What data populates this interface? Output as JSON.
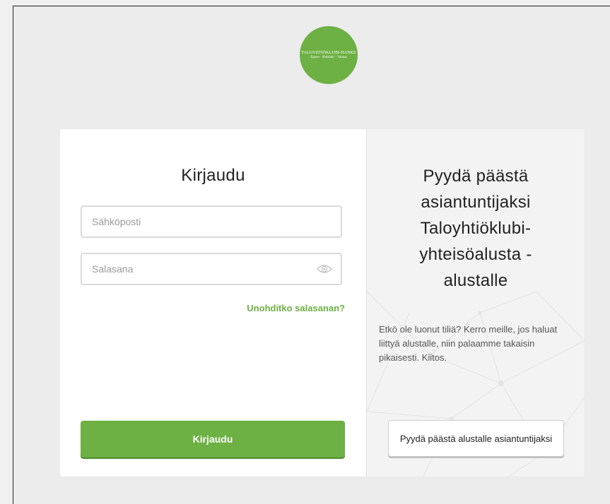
{
  "logo": {
    "line1": "TALOYHTIÖKLUBI-HANKE",
    "line2": "Espoo · Helsinki · Vantaa",
    "color": "#6db043"
  },
  "login": {
    "title": "Kirjaudu",
    "email_placeholder": "Sähköposti",
    "email_value": "",
    "password_placeholder": "Salasana",
    "password_value": "",
    "password_toggle_icon": "eye-icon",
    "forgot_link": "Unohditko salasanan?",
    "submit_label": "Kirjaudu"
  },
  "request": {
    "title_lines": [
      "Pyydä päästä",
      "asiantuntijaksi",
      "Taloyhtiöklubi-",
      "yhteisöalusta -",
      "alustalle"
    ],
    "text": "Etkö ole luonut tiliä? Kerro meille, jos haluat liittyä alustalle, niin palaamme takaisin pikaisesti. Kiitos.",
    "button_label": "Pyydä päästä alustalle asiantuntijaksi"
  },
  "colors": {
    "accent": "#6db043",
    "page_background": "#ececec"
  }
}
